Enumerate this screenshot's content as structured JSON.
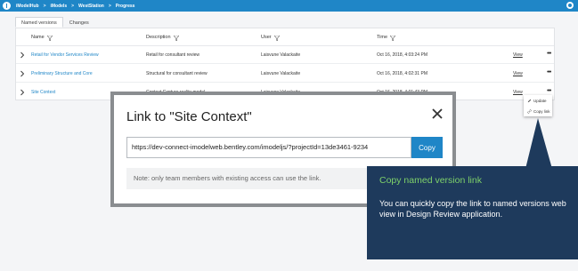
{
  "topbar": {
    "breadcrumbs": [
      "iModelHub",
      "iModels",
      "WestStation",
      "Progress"
    ],
    "separator": ">"
  },
  "tabs": [
    {
      "label": "Named versions",
      "active": true
    },
    {
      "label": "Changes",
      "active": false
    }
  ],
  "table": {
    "headers": {
      "name": "Name",
      "description": "Description",
      "user": "User",
      "time": "Time"
    },
    "rows": [
      {
        "name": "Retail for Vendor Services Review",
        "description": "Retail for consultant review",
        "user": "Laisvune Valackaite",
        "time": "Oct 16, 2018, 4:03:24 PM",
        "action": "View",
        "more": "•••"
      },
      {
        "name": "Preliminary Structure and Core",
        "description": "Structural for consultant review",
        "user": "Laisvune Valackaite",
        "time": "Oct 16, 2018, 4:02:31 PM",
        "action": "View",
        "more": "•••"
      },
      {
        "name": "Site Context",
        "description": "Context Capture reality model",
        "user": "Laisvune Valackaite",
        "time": "Oct 16, 2018, 4:01:43 PM",
        "action": "View",
        "more": "•••"
      }
    ]
  },
  "context_menu": {
    "items": [
      {
        "label": "Update",
        "icon": "pencil-icon"
      },
      {
        "label": "Copy link",
        "icon": "link-icon"
      }
    ]
  },
  "modal": {
    "title": "Link to \"Site Context\"",
    "url_value": "https://dev-connect-imodelweb.bentley.com/imodeljs/?projectId=13de3461-9234",
    "copy_label": "Copy",
    "note": "Note: only team members with existing access can use the link."
  },
  "callout": {
    "title": "Copy named version link",
    "body": "You can quickly copy the link to named versions web view in Design Review application."
  },
  "colors": {
    "accent": "#1f86c7",
    "callout_bg": "#1e3a5c",
    "callout_title": "#7ed16a"
  }
}
